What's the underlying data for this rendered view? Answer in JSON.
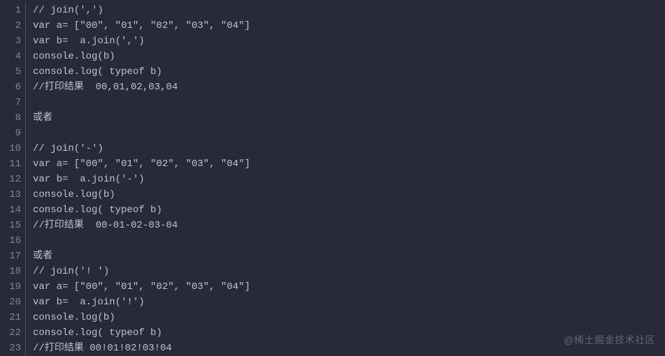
{
  "code": {
    "lines": [
      {
        "num": "1",
        "text": "// join(',')"
      },
      {
        "num": "2",
        "text": "var a= [\"00\", \"01\", \"02\", \"03\", \"04\"]"
      },
      {
        "num": "3",
        "text": "var b=  a.join(',')"
      },
      {
        "num": "4",
        "text": "console.log(b)"
      },
      {
        "num": "5",
        "text": "console.log( typeof b)"
      },
      {
        "num": "6",
        "text": "//打印结果  00,01,02,03,04"
      },
      {
        "num": "7",
        "text": ""
      },
      {
        "num": "8",
        "text": "或者"
      },
      {
        "num": "9",
        "text": ""
      },
      {
        "num": "10",
        "text": "// join('-')"
      },
      {
        "num": "11",
        "text": "var a= [\"00\", \"01\", \"02\", \"03\", \"04\"]"
      },
      {
        "num": "12",
        "text": "var b=  a.join('-')"
      },
      {
        "num": "13",
        "text": "console.log(b)"
      },
      {
        "num": "14",
        "text": "console.log( typeof b)"
      },
      {
        "num": "15",
        "text": "//打印结果  00-01-02-03-04"
      },
      {
        "num": "16",
        "text": ""
      },
      {
        "num": "17",
        "text": "或者"
      },
      {
        "num": "18",
        "text": "// join('! ')"
      },
      {
        "num": "19",
        "text": "var a= [\"00\", \"01\", \"02\", \"03\", \"04\"]"
      },
      {
        "num": "20",
        "text": "var b=  a.join('!')"
      },
      {
        "num": "21",
        "text": "console.log(b)"
      },
      {
        "num": "22",
        "text": "console.log( typeof b)"
      },
      {
        "num": "23",
        "text": "//打印结果 00!01!02!03!04"
      }
    ]
  },
  "watermark": "@稀土掘金技术社区"
}
